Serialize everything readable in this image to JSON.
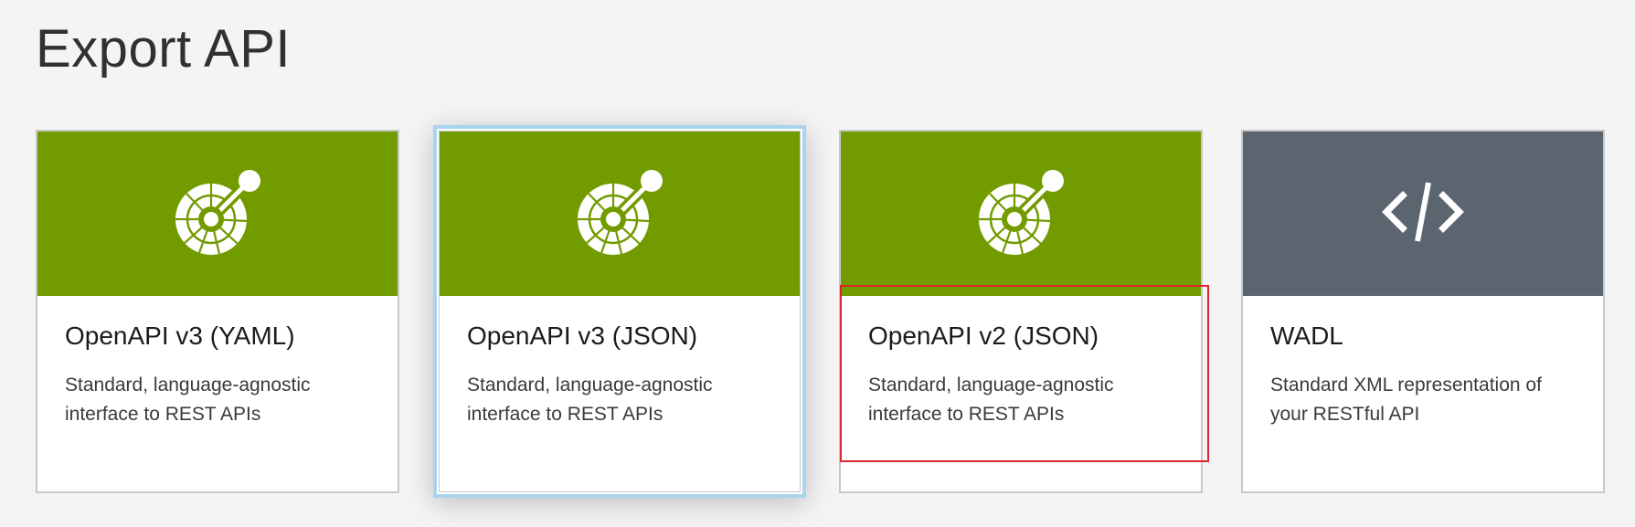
{
  "page": {
    "title": "Export API"
  },
  "cards": [
    {
      "title": "OpenAPI v3 (YAML)",
      "description": "Standard, language-agnostic interface to REST APIs",
      "icon": "openapi-icon",
      "header_color": "#729b00",
      "selected": false
    },
    {
      "title": "OpenAPI v3 (JSON)",
      "description": "Standard, language-agnostic interface to REST APIs",
      "icon": "openapi-icon",
      "header_color": "#729b00",
      "selected": true
    },
    {
      "title": "OpenAPI v2 (JSON)",
      "description": "Standard, language-agnostic interface to REST APIs",
      "icon": "openapi-icon",
      "header_color": "#729b00",
      "selected": false,
      "annotated": true
    },
    {
      "title": "WADL",
      "description": "Standard XML representation of your RESTful API",
      "icon": "code-icon",
      "header_color": "#5a6570",
      "selected": false
    }
  ],
  "colors": {
    "openapi_green": "#729b00",
    "wadl_gray": "#5a6570",
    "selection_border": "#a9d4ef",
    "annotation_red": "#e0242c",
    "background": "#f4f4f4"
  }
}
